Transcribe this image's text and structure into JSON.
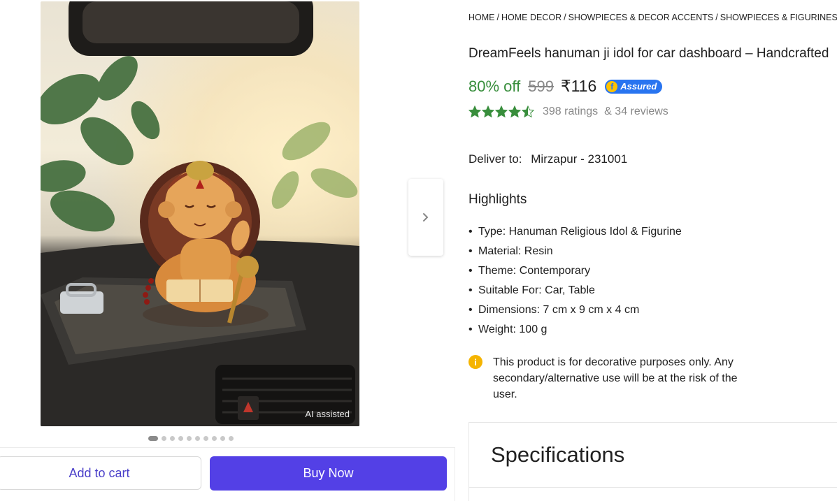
{
  "gallery": {
    "ai_tag": "AI assisted",
    "next_icon": "chevron-right-icon",
    "dot_count": 10,
    "active_dot": 1
  },
  "actions": {
    "add_to_cart": "Add to cart",
    "buy_now": "Buy Now"
  },
  "breadcrumb": [
    "HOME",
    "HOME DECOR",
    "SHOWPIECES & DECOR ACCENTS",
    "SHOWPIECES & FIGURINES"
  ],
  "product": {
    "title": "DreamFeels hanuman ji idol for car dashboard – Handcrafted",
    "discount": "80% off",
    "mrp": "599",
    "price": "₹116",
    "assured": "Assured",
    "rating": 4.5,
    "ratings_count": "398 ratings",
    "reviews": "& 34 reviews"
  },
  "delivery": {
    "label": "Deliver to:",
    "location": "Mirzapur - 231001"
  },
  "highlights": {
    "title": "Highlights",
    "items": [
      "Type: Hanuman Religious Idol & Figurine",
      "Material: Resin",
      "Theme: Contemporary",
      "Suitable For: Car, Table",
      "Dimensions: 7 cm x 9 cm x 4 cm",
      "Weight: 100 g"
    ]
  },
  "notice": {
    "icon": "info-icon",
    "text": "This product is for decorative purposes only. Any secondary/alternative use will be at the risk of the user."
  },
  "specifications": {
    "title": "Specifications"
  },
  "colors": {
    "green": "#388e3c",
    "buy_now": "#5340e6",
    "cart_text": "#4a3fc9",
    "star": "#388e3c",
    "assured_blue": "#2874f0"
  }
}
